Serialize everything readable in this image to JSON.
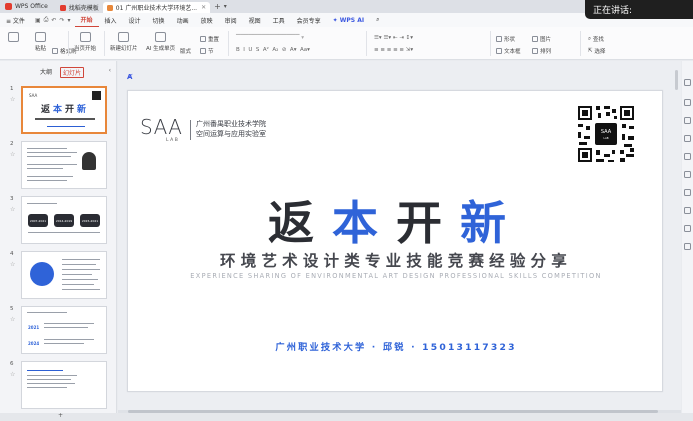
{
  "titlebar": {
    "app_name": "WPS Office",
    "tabs": [
      {
        "label": "找稻壳模板",
        "color": "#e23b2e"
      },
      {
        "label": "01 广州职业技术大学环境艺...",
        "color": "#e8873a"
      }
    ],
    "add_tab": "+",
    "speaking_label": "正在讲话:"
  },
  "menubar": {
    "file_label": "≡ 文件",
    "items": [
      "开始",
      "插入",
      "设计",
      "切换",
      "动画",
      "放映",
      "审阅",
      "视图",
      "工具",
      "会员专享"
    ],
    "active_item": "开始",
    "ai_label": "WPS AI"
  },
  "ribbon": {
    "paste_label": "粘贴",
    "format_painter_label": "格式刷",
    "current_start_label": "当页开始",
    "new_slide_label": "新建幻灯片",
    "ai_generate_label": "AI 生成单页",
    "layout_label": "版式",
    "section_label": "节",
    "reset_label": "重置",
    "shape_label": "形状",
    "picture_label": "图片",
    "textbox_label": "文本框",
    "arrange_label": "排列",
    "find_label": "查找",
    "select_label": "选择"
  },
  "leftpanel": {
    "tab_outline": "大纲",
    "tab_slides": "幻灯片",
    "collapse": "‹",
    "slide_numbers": [
      "1",
      "2",
      "3",
      "4",
      "5",
      "6"
    ]
  },
  "slide": {
    "logo_text": "SAA",
    "logo_sub": "LAB",
    "school_line1": "广州番禺职业技术学院",
    "school_line2": "空间运算与应用实验室",
    "title_chars": [
      "返",
      "本",
      "开",
      "新"
    ],
    "subtitle_cn": "环境艺术设计类专业技能竞赛经验分享",
    "subtitle_en": "EXPERIENCE SHARING OF ENVIRONMENTAL ART DESIGN PROFESSIONAL SKILLS COMPETITION",
    "author_line": "广州职业技术大学 · 邱锐 · 15013117323",
    "title_colors": {
      "dark": "#2b2d33",
      "blue": "#2f63d8"
    }
  },
  "thumbs": {
    "slide3_years": [
      "2007-2021",
      "2014-2019",
      "2015-2021"
    ],
    "slide5_years": [
      "2021",
      "2024"
    ]
  }
}
